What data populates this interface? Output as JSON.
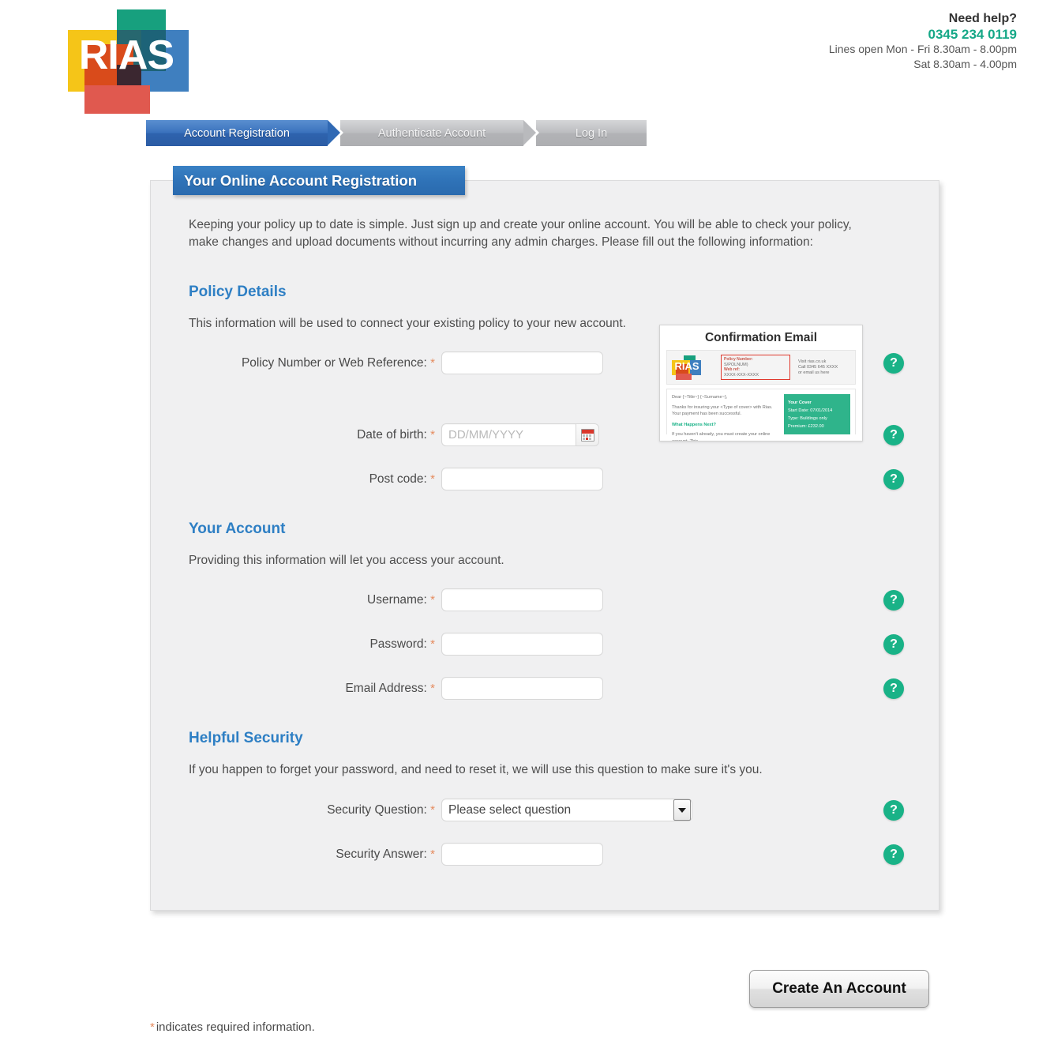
{
  "header": {
    "logo_text": "RIAS",
    "help_title": "Need help?",
    "phone": "0345 234 0119",
    "hours_weekday": "Lines open Mon - Fri 8.30am - 8.00pm",
    "hours_saturday": "Sat 8.30am - 4.00pm"
  },
  "steps": [
    {
      "label": "Account Registration",
      "state": "active"
    },
    {
      "label": "Authenticate Account",
      "state": "inactive"
    },
    {
      "label": "Log In",
      "state": "inactive"
    }
  ],
  "panel": {
    "title": "Your Online Account Registration",
    "intro": "Keeping your policy up to date is simple. Just sign up and create your online account. You will be able to check your policy, make changes and upload documents without incurring any admin charges. Please fill out the following information:"
  },
  "policy_details": {
    "heading": "Policy Details",
    "description": "This information will be used to connect your existing policy to your new account.",
    "fields": [
      {
        "label": "Policy Number or Web Reference:",
        "required": "*",
        "value": "",
        "placeholder": ""
      },
      {
        "label": "Date of birth:",
        "required": "*",
        "value": "",
        "placeholder": "DD/MM/YYYY"
      },
      {
        "label": "Post code:",
        "required": "*",
        "value": "",
        "placeholder": ""
      }
    ]
  },
  "your_account": {
    "heading": "Your Account",
    "description": "Providing this information will let you access your account.",
    "fields": [
      {
        "label": "Username:",
        "required": "*",
        "value": "",
        "placeholder": ""
      },
      {
        "label": "Password:",
        "required": "*",
        "value": "",
        "placeholder": ""
      },
      {
        "label": "Email Address:",
        "required": "*",
        "value": "",
        "placeholder": ""
      }
    ]
  },
  "helpful_security": {
    "heading": "Helpful Security",
    "description": "If you happen to forget your password, and need to reset it, we will use this question to make sure it's you.",
    "question_label": "Security Question:",
    "question_required": "*",
    "question_selected": "Please select question",
    "answer_label": "Security Answer:",
    "answer_required": "*",
    "answer_value": ""
  },
  "confirmation_email": {
    "title": "Confirmation Email",
    "logo_text": "RIAS",
    "policy_box": {
      "policy_label": "Policy Number:",
      "policy_value": "S/POLNUM)",
      "web_label": "Web ref:",
      "web_value": "XXXX-XXX-XXXX"
    },
    "contact": {
      "visit": "Visit rias.co.uk",
      "call": "Call 0345 645 XXXX",
      "email": "or email us here"
    },
    "message": {
      "greeting": "Dear {~Title~} {~Surname~},",
      "line1": "Thanks for insuring your <Type of cover> with Rias.",
      "line2": "Your payment has been successful.",
      "subheading": "What Happens Next?",
      "line3": "If you haven't already, you must create your online account. This"
    },
    "cover_box": {
      "title": "Your Cover",
      "start_date": "Start Date: 07/01/2014",
      "type": "Type: Buildings only",
      "premium": "Premium: £232.00"
    }
  },
  "help_icon": {
    "glyph": "?",
    "name": "help-icon"
  },
  "footer": {
    "submit_label": "Create An Account",
    "required_marker": "*",
    "required_note": "indicates required information."
  },
  "colors": {
    "brand_blue": "#2f73b8",
    "accent_green": "#19b287",
    "required_orange": "#e58b5e",
    "panel_bg": "#f0f0f1"
  }
}
